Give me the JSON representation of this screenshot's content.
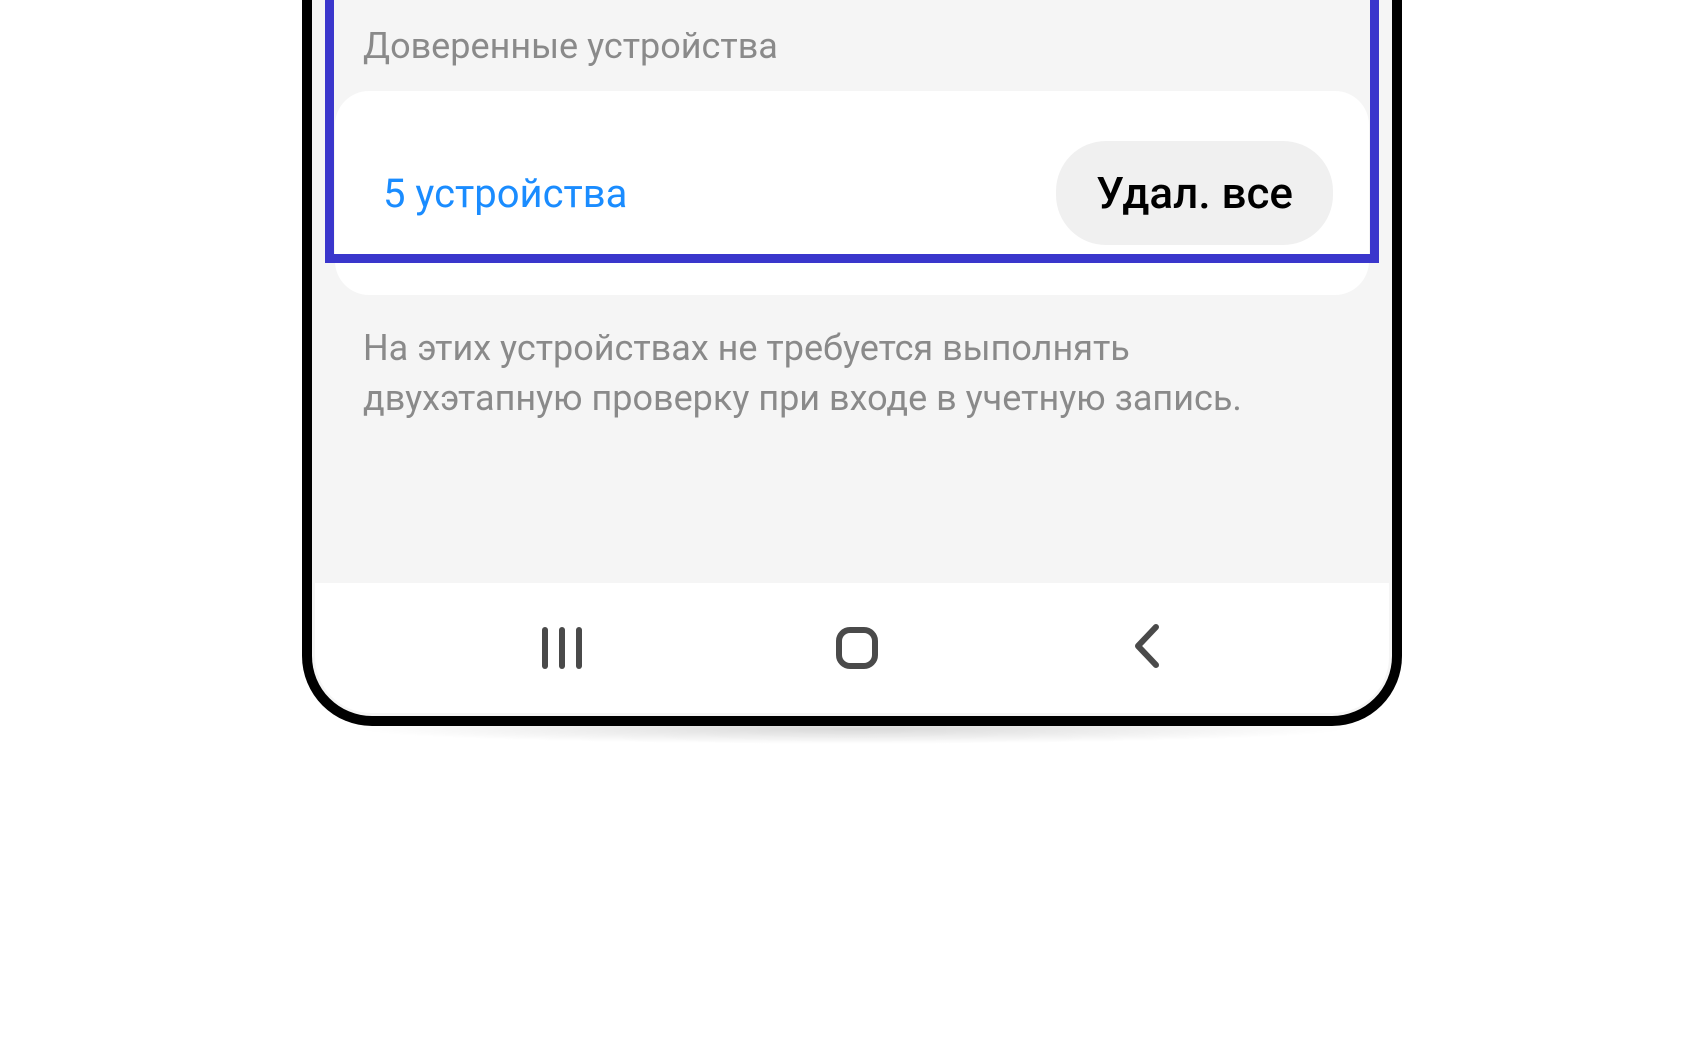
{
  "section": {
    "title": "Доверенные устройства"
  },
  "devices": {
    "count_label": "5 устройства",
    "delete_all_label": "Удал. все"
  },
  "description": {
    "text": "На этих устройствах не требуется выполнять двухэтапную проверку при входе в учетную запись."
  },
  "colors": {
    "highlight": "#3a36cc",
    "link": "#1a8cff",
    "muted": "#8a8a8a"
  }
}
